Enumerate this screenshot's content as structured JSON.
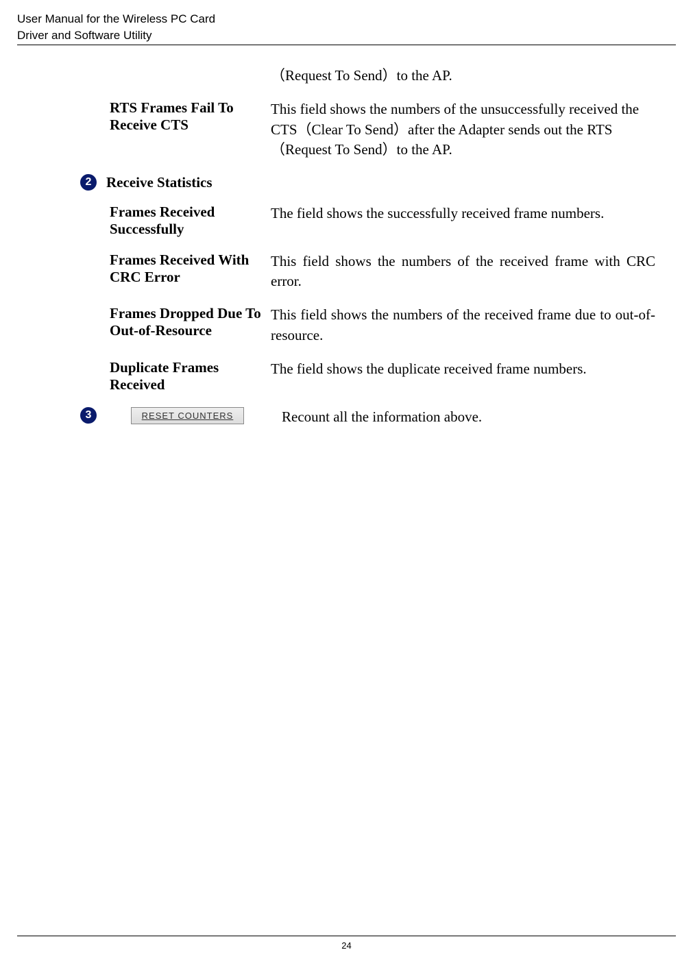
{
  "header": {
    "line1": "User Manual for the Wireless PC Card",
    "line2": "Driver and Software Utility"
  },
  "section1": {
    "intro_desc": "（Request To Send）to the AP.",
    "rts_fail": {
      "label": "RTS Frames Fail To Receive CTS",
      "desc": "This field shows the numbers of the unsuccessfully received the CTS（Clear To Send）after the Adapter sends out the RTS （Request To Send）to the AP."
    }
  },
  "section2": {
    "badge": "2",
    "title": "Receive Statistics",
    "rows": [
      {
        "label": "Frames Received Successfully",
        "desc": "The field shows the successfully received frame numbers."
      },
      {
        "label": "Frames Received With CRC Error",
        "desc": "This field shows the numbers of the received frame with CRC error."
      },
      {
        "label": "Frames Dropped Due To Out-of-Resource",
        "desc": "This field shows the numbers of the received frame due to out-of-resource."
      },
      {
        "label": "Duplicate Frames Received",
        "desc": "The field shows the duplicate received frame numbers."
      }
    ]
  },
  "section3": {
    "badge": "3",
    "button_label": "RESET COUNTERS",
    "desc": "Recount all the information above."
  },
  "page_number": "24"
}
